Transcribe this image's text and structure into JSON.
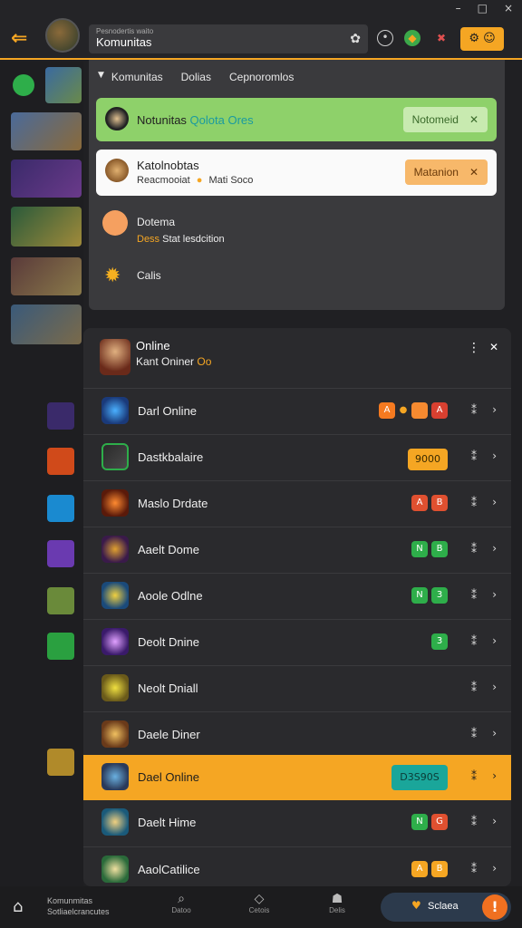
{
  "window": {
    "minimize": "–",
    "maximize": "□",
    "close": "×"
  },
  "header": {
    "back_icon": "arrow-left",
    "search_tiny": "Pesnodertis waito",
    "search_value": "Komunitas",
    "star_icon": "star",
    "orange_btn": "⚙ ☺"
  },
  "dropdown": {
    "tabs": [
      "Komunitas",
      "Dolias",
      "Cepnoromlos"
    ],
    "green_card": {
      "title": "Notunitas",
      "accent": "Qolota Ores",
      "button": "Notomeid"
    },
    "white_card": {
      "title": "Katolnobtas",
      "subtitle": "Reacmooiat",
      "subtitle2": "Mati Soco",
      "button": "Matanion"
    },
    "item1": {
      "title": "Dotema",
      "subtitle_gold": "Dess",
      "subtitle": "Stat lesdcition"
    },
    "item2": {
      "title": "Calis"
    }
  },
  "list": {
    "header_title": "Online",
    "header_sub": "Kant Oniner",
    "header_sub_gold": "Oo",
    "games": [
      {
        "name": "Darl Online",
        "badges": [
          "A",
          "",
          "A"
        ]
      },
      {
        "name": "Dastkbalaire",
        "badges": [
          "9000"
        ]
      },
      {
        "name": "Maslo Drdate",
        "badges": [
          "A",
          "B"
        ]
      },
      {
        "name": "Aaelt Dome",
        "badges": [
          "N",
          "B"
        ]
      },
      {
        "name": "Aoole Odlne",
        "badges": [
          "N",
          "3"
        ]
      },
      {
        "name": "Deolt Dnine",
        "badges": [
          "3"
        ]
      },
      {
        "name": "Neolt Dniall",
        "badges": []
      },
      {
        "name": "Daele Diner",
        "badges": []
      },
      {
        "name": "Dael Online",
        "badges": [
          "D3S90S"
        ]
      },
      {
        "name": "Daelt Hime",
        "badges": [
          "N",
          "G"
        ]
      },
      {
        "name": "AaolCatilice",
        "badges": [
          "A",
          "B"
        ]
      }
    ]
  },
  "bottomnav": {
    "text1": "Komunmitas",
    "text2": "Sotliaelcrancutes",
    "items": [
      {
        "label": "Datoo"
      },
      {
        "label": "Cetois"
      },
      {
        "label": "Delis"
      }
    ],
    "pill_label": "Sclaea",
    "fab_label": "!"
  },
  "colors": {
    "accent": "#f5a623",
    "green": "#8ed16a",
    "teal": "#1aa69a",
    "bg": "#202023"
  }
}
